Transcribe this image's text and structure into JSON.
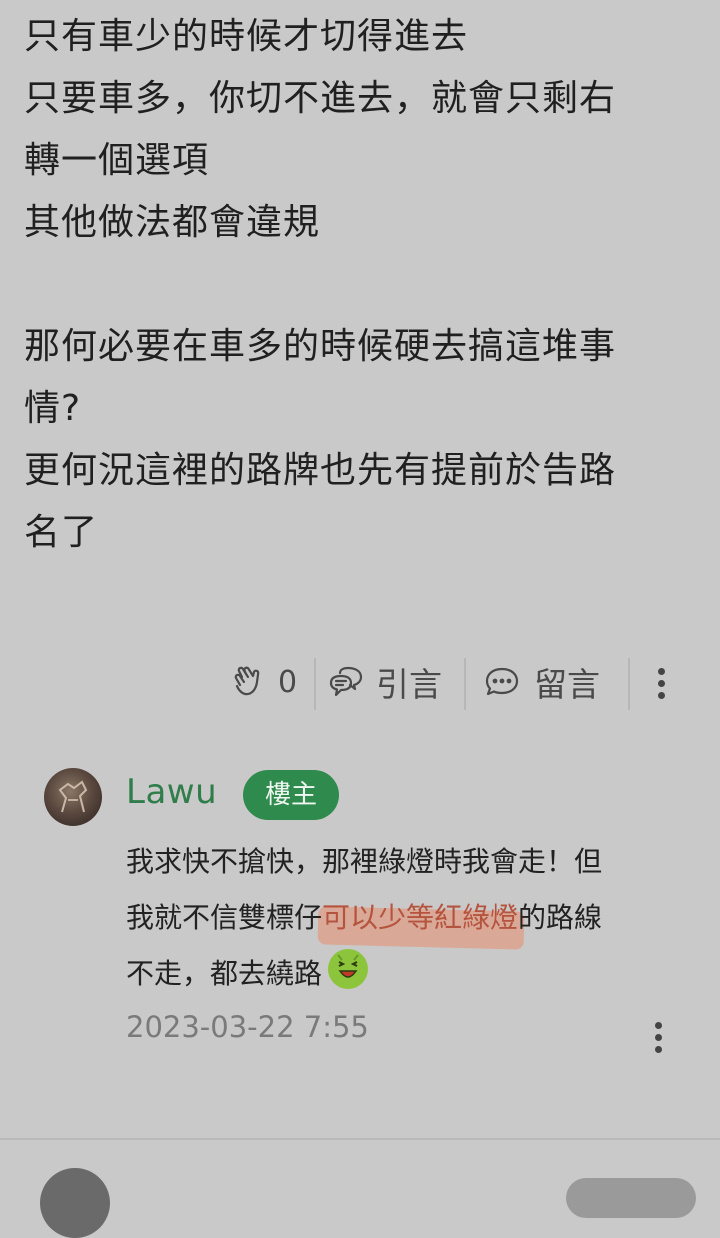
{
  "post": {
    "lines": [
      "只有車少的時候才切得進去",
      "只要車多，你切不進去，就會只剩右",
      "轉一個選項",
      "其他做法都會違規",
      "",
      "那何必要在車多的時候硬去搞這堆事",
      "情?",
      "更何況這裡的路牌也先有提前於告路",
      "名了"
    ]
  },
  "actions": {
    "like_count": "0",
    "quote_label": "引言",
    "comment_label": "留言"
  },
  "reply": {
    "author": "Lawu",
    "badge": "樓主",
    "line1": "我求快不搶快，那裡綠燈時我會走！但",
    "line2_a": "我就不信雙標仔",
    "line2_hl": "可以少等紅綠燈",
    "line2_b": "的路線",
    "line3": "不走，都去繞路",
    "timestamp": "2023-03-22 7:55"
  },
  "colors": {
    "background": "#c9c9c9",
    "author": "#2e7d4a",
    "badge_bg": "#2f8a4e",
    "highlight": "#e88c6e"
  }
}
